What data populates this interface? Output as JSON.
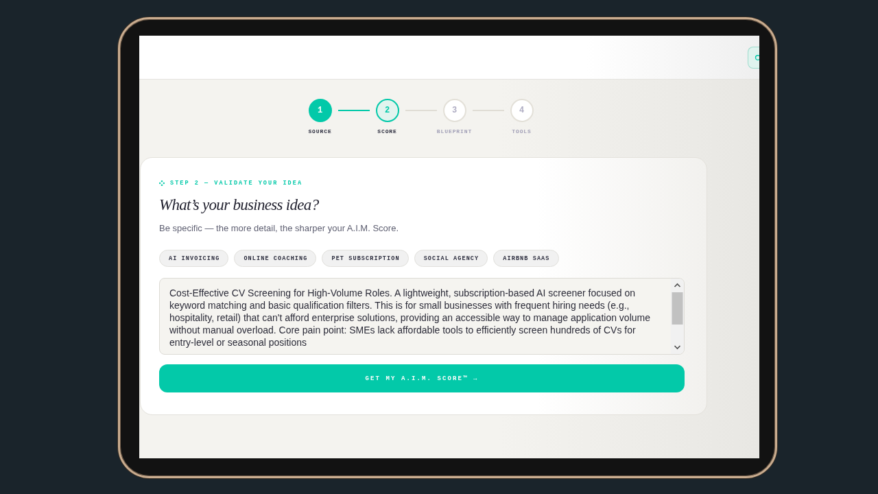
{
  "steps": [
    {
      "number": "1",
      "label": "SOURCE",
      "kind": "done"
    },
    {
      "number": "2",
      "label": "SCORE",
      "kind": "current"
    },
    {
      "number": "3",
      "label": "BLUEPRINT",
      "kind": "upcoming"
    },
    {
      "number": "4",
      "label": "TOOLS",
      "kind": "upcoming"
    }
  ],
  "card": {
    "eyebrow": "STEP 2 — VALIDATE YOUR IDEA",
    "title": "What’s your business idea?",
    "subtitle": "Be specific — the more detail, the sharper your A.I.M. Score.",
    "suggestions": [
      "AI INVOICING",
      "ONLINE COACHING",
      "PET SUBSCRIPTION",
      "SOCIAL AGENCY",
      "AIRBNB SAAS"
    ],
    "idea": {
      "value": "Cost-Effective CV Screening for High-Volume Roles. A lightweight, subscription-based AI screener focused on keyword matching and basic qualification filters. This is for small businesses with frequent hiring needs (e.g., hospitality, retail) that can't afford enterprise solutions, providing an accessible way to manage application volume without manual overload. Core pain point: SMEs lack affordable tools to efficiently screen hundreds of CVs for entry-level or seasonal positions"
    },
    "submit_button": "GET MY A.I.M. SCORE™ →"
  }
}
